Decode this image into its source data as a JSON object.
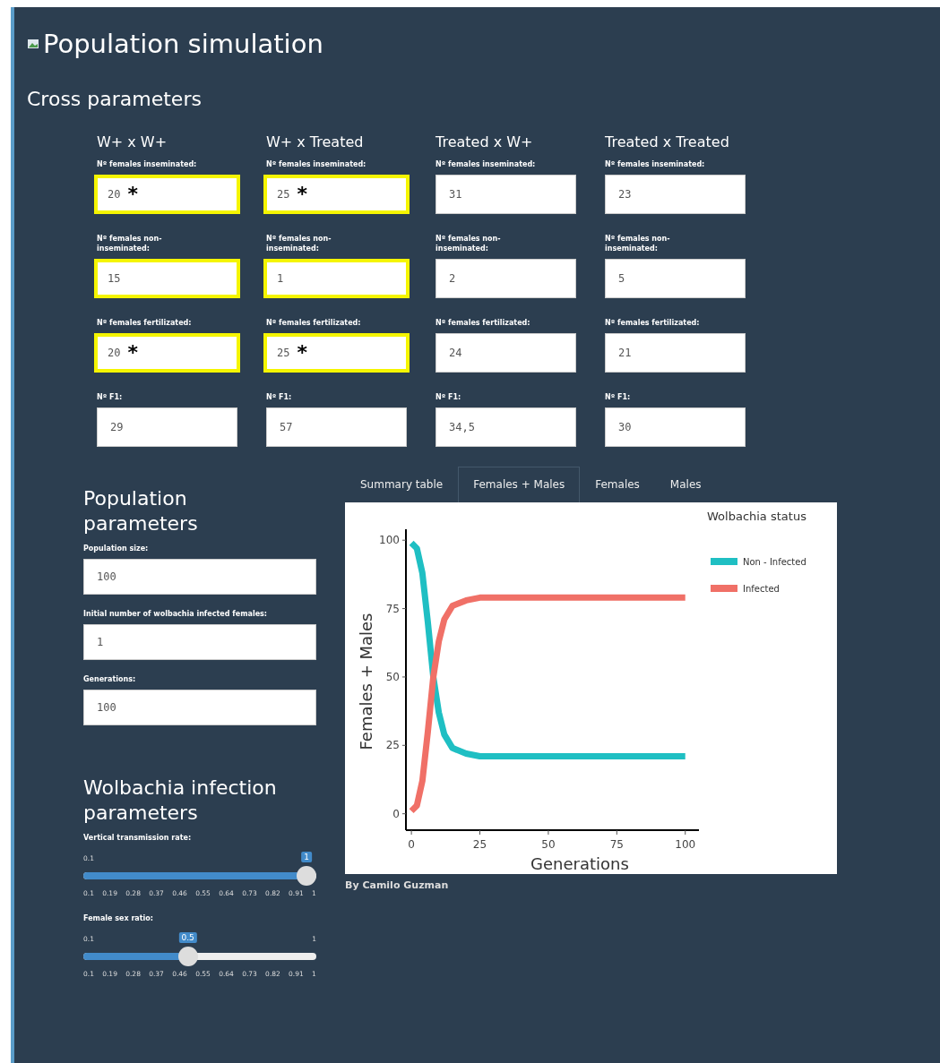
{
  "title": "Population simulation",
  "cross_section": {
    "heading": "Cross parameters",
    "columns": [
      {
        "heading": "W+ x W+",
        "fields": [
          {
            "label": "Nº females inseminated:",
            "value": "20",
            "highlighted": true,
            "note": "*"
          },
          {
            "label": "Nº females non-inseminated:",
            "value": "15",
            "highlighted": true
          },
          {
            "label": "Nº females fertilizated:",
            "value": "20",
            "highlighted": true,
            "note": "*"
          },
          {
            "label": "Nº F1:",
            "value": "29",
            "highlighted": false
          }
        ]
      },
      {
        "heading": "W+ x Treated",
        "fields": [
          {
            "label": "Nº females inseminated:",
            "value": "25",
            "highlighted": true,
            "note": "*"
          },
          {
            "label": "Nº females non-inseminated:",
            "value": "1",
            "highlighted": true
          },
          {
            "label": "Nº females fertilizated:",
            "value": "25",
            "highlighted": true,
            "note": "*"
          },
          {
            "label": "Nº F1:",
            "value": "57",
            "highlighted": false
          }
        ]
      },
      {
        "heading": "Treated x W+",
        "fields": [
          {
            "label": "Nº females inseminated:",
            "value": "31",
            "highlighted": false
          },
          {
            "label": "Nº females non-inseminated:",
            "value": "2",
            "highlighted": false
          },
          {
            "label": "Nº females fertilizated:",
            "value": "24",
            "highlighted": false
          },
          {
            "label": "Nº F1:",
            "value": "34,5",
            "highlighted": false
          }
        ]
      },
      {
        "heading": "Treated x Treated",
        "fields": [
          {
            "label": "Nº females inseminated:",
            "value": "23",
            "highlighted": false
          },
          {
            "label": "Nº females non-inseminated:",
            "value": "5",
            "highlighted": false
          },
          {
            "label": "Nº females fertilizated:",
            "value": "21",
            "highlighted": false
          },
          {
            "label": "Nº F1:",
            "value": "30",
            "highlighted": false
          }
        ]
      }
    ]
  },
  "population_section": {
    "heading": "Population parameters",
    "fields": [
      {
        "label": "Population size:",
        "value": "100"
      },
      {
        "label": "Initial number of wolbachia infected females:",
        "value": "1"
      },
      {
        "label": "Generations:",
        "value": "100"
      }
    ]
  },
  "infection_section": {
    "heading": "Wolbachia infection parameters",
    "sliders": [
      {
        "label": "Vertical transmission rate:",
        "min_label": "0.1",
        "value_label": "1",
        "level": 1,
        "ticks": [
          "0.1",
          "0.19",
          "0.28",
          "0.37",
          "0.46",
          "0.55",
          "0.64",
          "0.73",
          "0.82",
          "0.91",
          "1"
        ]
      },
      {
        "label": "Female sex ratio:",
        "min_label": "0.1",
        "max_label": "1",
        "value_label": "0.5",
        "level": 0.444,
        "ticks": [
          "0.1",
          "0.19",
          "0.28",
          "0.37",
          "0.46",
          "0.55",
          "0.64",
          "0.73",
          "0.82",
          "0.91",
          "1"
        ]
      }
    ]
  },
  "tabs": [
    {
      "label": "Summary table",
      "selected": false
    },
    {
      "label": "Females + Males",
      "selected": true
    },
    {
      "label": "Females",
      "selected": false
    },
    {
      "label": "Males",
      "selected": false
    }
  ],
  "chart": {
    "chart_data": {
      "type": "line",
      "xlabel": "Generations",
      "ylabel": "Females + Males",
      "x": [
        0,
        2,
        4,
        6,
        8,
        10,
        12,
        15,
        20,
        25,
        50,
        75,
        100
      ],
      "series": [
        {
          "name": "Non - Infected",
          "color": "#1fbfc3",
          "values": [
            99,
            97,
            88,
            70,
            50,
            37,
            29,
            24,
            22,
            21,
            21,
            21,
            21
          ]
        },
        {
          "name": "Infected",
          "color": "#f07067",
          "values": [
            1,
            3,
            12,
            30,
            50,
            63,
            71,
            76,
            78,
            79,
            79,
            79,
            79
          ]
        }
      ],
      "xlim": [
        -2,
        105
      ],
      "ylim": [
        -6,
        104
      ],
      "xticks": [
        0,
        25,
        50,
        75,
        100
      ],
      "yticks": [
        0,
        25,
        50,
        75,
        100
      ],
      "legend": {
        "title": "Wolbachia status"
      }
    }
  },
  "credit": "By Camilo Guzman"
}
